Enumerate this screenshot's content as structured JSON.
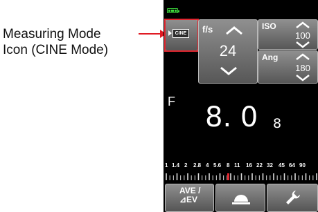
{
  "annotation": {
    "line1": "Measuring Mode",
    "line2": "Icon (CINE Mode)"
  },
  "meter": {
    "battery_icon": "battery-full-icon",
    "mode": {
      "icon": "cine-mode-icon",
      "label": "CINE"
    },
    "fps": {
      "label": "f/s",
      "value": "24"
    },
    "iso": {
      "label": "ISO",
      "value": "100"
    },
    "angle": {
      "label": "Ang",
      "value": "180"
    },
    "aperture": {
      "label": "F",
      "value": "8. 0",
      "tenths": "8"
    },
    "scale": {
      "labels": [
        "1",
        "1.4",
        "2",
        "2.8",
        "4",
        "5.6",
        "8",
        "11",
        "16",
        "22",
        "32",
        "45",
        "64",
        "90"
      ],
      "indicator_value": "8.8"
    },
    "buttons": {
      "ave_line1": "AVE  /",
      "ave_line2": "⊿EV",
      "dome_icon": "light-dome-icon",
      "tool_icon": "wrench-icon"
    }
  },
  "colors": {
    "highlight": "#e0262f",
    "battery": "#3ddc3d",
    "scale_indicator": "#e0262f"
  }
}
